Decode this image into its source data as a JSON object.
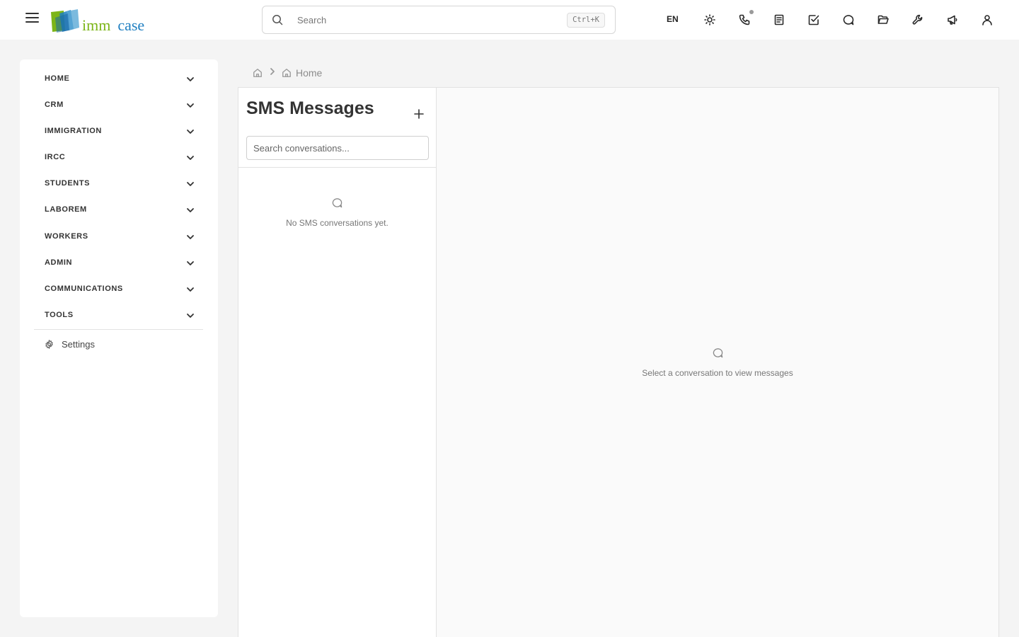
{
  "header": {
    "logo": {
      "part1": "imm",
      "part2": "case",
      "brand_green": "#7cb518",
      "brand_blue": "#1f7fc1"
    },
    "search": {
      "placeholder": "Search",
      "shortcut": "Ctrl+K"
    },
    "language": "EN",
    "icons": [
      "theme-sun-icon",
      "phone-icon",
      "notes-icon",
      "tasks-check-icon",
      "chat-icon",
      "folder-open-icon",
      "wrench-icon",
      "megaphone-icon",
      "user-icon"
    ]
  },
  "sidebar": {
    "items": [
      {
        "label": "HOME"
      },
      {
        "label": "CRM"
      },
      {
        "label": "IMMIGRATION"
      },
      {
        "label": "IRCC"
      },
      {
        "label": "STUDENTS"
      },
      {
        "label": "LABOREM"
      },
      {
        "label": "WORKERS"
      },
      {
        "label": "ADMIN"
      },
      {
        "label": "COMMUNICATIONS"
      },
      {
        "label": "TOOLS"
      }
    ],
    "settings_label": "Settings"
  },
  "breadcrumb": {
    "current": "Home"
  },
  "sms": {
    "title": "SMS Messages",
    "search_placeholder": "Search conversations...",
    "empty_list_text": "No SMS conversations yet.",
    "empty_detail_text": "Select a conversation to view messages"
  }
}
